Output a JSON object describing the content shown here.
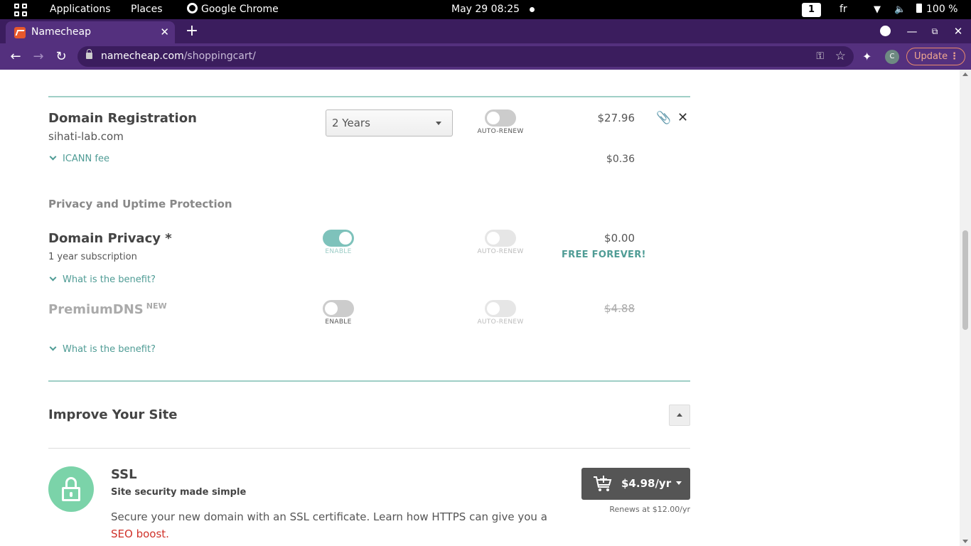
{
  "system_bar": {
    "applications": "Applications",
    "places": "Places",
    "app_name": "Google Chrome",
    "datetime": "May 29  08:25",
    "workspace": "1",
    "keyboard_layout": "fr",
    "battery": "100 %"
  },
  "browser": {
    "tab_title": "Namecheap",
    "url_domain": "namecheap.com",
    "url_path": "/shoppingcart/",
    "profile_initial": "C",
    "update_label": "Update"
  },
  "cart": {
    "domain_registration": {
      "title": "Domain Registration",
      "domain": "sihati-lab.com",
      "period": "2 Years",
      "auto_renew_label": "AUTO-RENEW",
      "price": "$27.96",
      "icann_label": "ICANN fee",
      "icann_price": "$0.36"
    },
    "privacy_section_title": "Privacy and Uptime Protection",
    "domain_privacy": {
      "title": "Domain Privacy *",
      "subtitle": "1 year subscription",
      "enable_label": "ENABLE",
      "enabled": true,
      "auto_renew_label": "AUTO-RENEW",
      "price": "$0.00",
      "badge": "FREE FOREVER!",
      "benefit_link": "What is the benefit?"
    },
    "premium_dns": {
      "title": "PremiumDNS",
      "badge": "NEW",
      "enable_label": "ENABLE",
      "enabled": false,
      "auto_renew_label": "AUTO-RENEW",
      "price": "$4.88",
      "benefit_link": "What is the benefit?"
    }
  },
  "improve_site": {
    "title": "Improve Your Site",
    "ssl": {
      "title": "SSL",
      "tagline": "Site security made simple",
      "description": "Secure your new domain with an SSL certificate. Learn how HTTPS can give you a",
      "link": "SEO boost.",
      "price": "$4.98/yr",
      "renews": "Renews at $12.00/yr"
    }
  },
  "colors": {
    "accent_teal": "#4f9c95",
    "chrome_purple": "#54307e",
    "ssl_green": "#7bd3a9",
    "seo_link_red": "#d0322a"
  }
}
